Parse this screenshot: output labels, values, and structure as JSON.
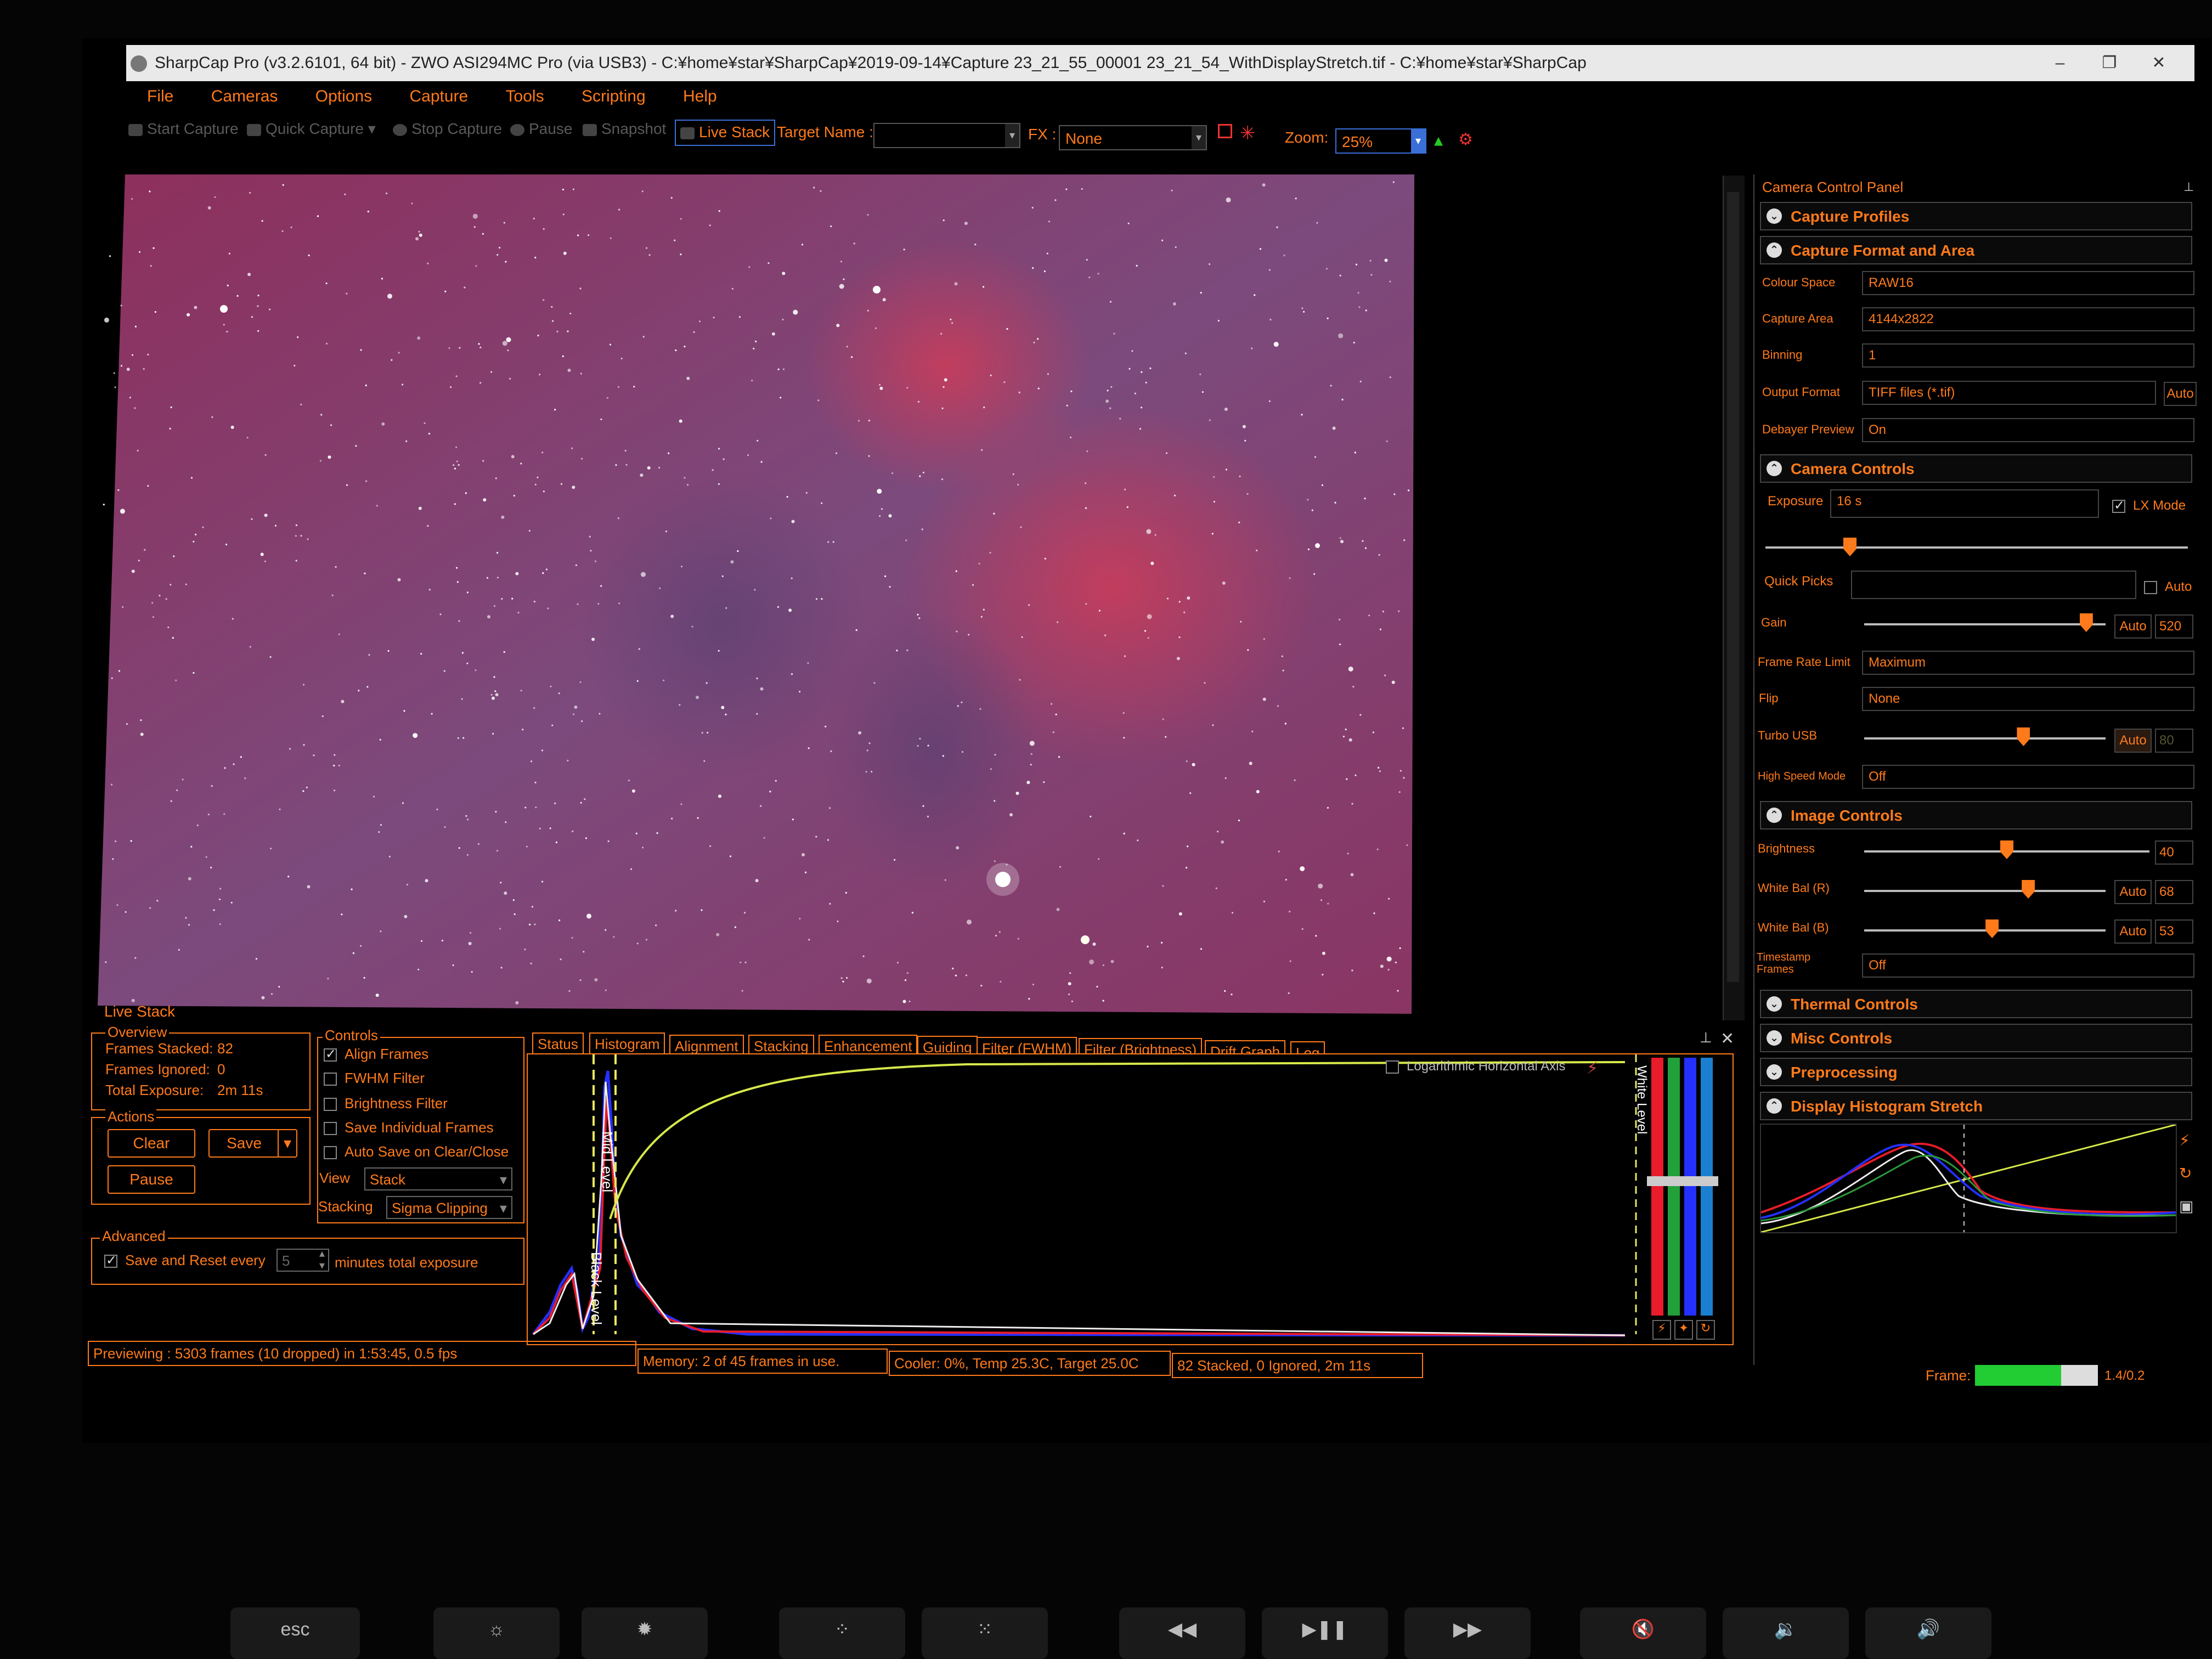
{
  "window": {
    "title": "SharpCap Pro (v3.2.6101, 64 bit) - ZWO ASI294MC Pro (via USB3) - C:¥home¥star¥SharpCap¥2019-09-14¥Capture 23_21_55_00001 23_21_54_WithDisplayStretch.tif - C:¥home¥star¥SharpCap",
    "min": "–",
    "max": "❐",
    "close": "✕"
  },
  "menu": [
    "File",
    "Cameras",
    "Options",
    "Capture",
    "Tools",
    "Scripting",
    "Help"
  ],
  "toolbar": {
    "start_capture": "Start Capture",
    "quick_capture": "Quick Capture",
    "stop_capture": "Stop Capture",
    "pause": "Pause",
    "snapshot": "Snapshot",
    "live_stack": "Live Stack",
    "target_name_label": "Target Name :",
    "target_name_value": "",
    "fx_label": "FX :",
    "fx_value": "None",
    "zoom_label": "Zoom:",
    "zoom_value": "25%"
  },
  "live_stack": {
    "title": "Live Stack",
    "overview": {
      "title": "Overview",
      "frames_stacked_label": "Frames Stacked:",
      "frames_stacked": "82",
      "frames_ignored_label": "Frames Ignored:",
      "frames_ignored": "0",
      "total_exposure_label": "Total Exposure:",
      "total_exposure": "2m 11s"
    },
    "actions": {
      "title": "Actions",
      "clear": "Clear",
      "save": "Save",
      "pause": "Pause"
    },
    "controls": {
      "title": "Controls",
      "align_frames": "Align Frames",
      "fwhm_filter": "FWHM Filter",
      "brightness_filter": "Brightness Filter",
      "save_individual": "Save Individual Frames",
      "auto_save": "Auto Save on Clear/Close",
      "view_label": "View",
      "view_value": "Stack",
      "stacking_label": "Stacking",
      "stacking_value": "Sigma Clipping"
    },
    "advanced": {
      "title": "Advanced",
      "save_reset": "Save and Reset every",
      "minutes_value": "5",
      "minutes_label": "minutes total exposure"
    }
  },
  "tabs": [
    "Status",
    "Histogram",
    "Alignment",
    "Stacking",
    "Enhancement",
    "Guiding",
    "Filter (FWHM)",
    "Filter (Brightness)",
    "Drift Graph",
    "Log"
  ],
  "histogram": {
    "log_axis": "Logarithmic Horizontal Axis",
    "mid_level": "Mid Level",
    "black_level": "Black Level",
    "white_level": "White Level"
  },
  "status": {
    "previewing": "Previewing : 5303 frames (10 dropped) in 1:53:45, 0.5 fps",
    "memory": "Memory: 2 of 45 frames in use.",
    "cooler": "Cooler: 0%, Temp 25.3C, Target 25.0C",
    "stacked": "82 Stacked, 0 Ignored, 2m 11s",
    "frame_label": "Frame:",
    "frame_value": "1.4/0.2",
    "frame_progress": 0.7
  },
  "control_panel": {
    "title": "Camera Control Panel",
    "pin": "📌",
    "sections": {
      "capture_profiles": "Capture Profiles",
      "capture_format": "Capture Format and Area",
      "camera_controls": "Camera Controls",
      "image_controls": "Image Controls",
      "thermal": "Thermal Controls",
      "misc": "Misc Controls",
      "preprocessing": "Preprocessing",
      "display_stretch": "Display Histogram Stretch"
    },
    "format": {
      "colour_space_label": "Colour Space",
      "colour_space": "RAW16",
      "capture_area_label": "Capture Area",
      "capture_area": "4144x2822",
      "binning_label": "Binning",
      "binning": "1",
      "output_format_label": "Output Format",
      "output_format": "TIFF files (*.tif)",
      "output_auto": "Auto",
      "debayer_label": "Debayer Preview",
      "debayer": "On"
    },
    "camera": {
      "exposure_label": "Exposure",
      "exposure": "16 s",
      "lx_mode": "LX Mode",
      "exposure_level": 0.2,
      "quick_picks_label": "Quick Picks",
      "quick_picks": "",
      "quick_auto": "Auto",
      "gain_label": "Gain",
      "gain_auto": "Auto",
      "gain": "520",
      "gain_level": 0.92,
      "frame_rate_label": "Frame Rate Limit",
      "frame_rate": "Maximum",
      "flip_label": "Flip",
      "flip": "None",
      "turbo_label": "Turbo USB",
      "turbo_auto": "Auto",
      "turbo": "80",
      "turbo_level": 0.66,
      "hsm_label": "High Speed Mode",
      "hsm": "Off"
    },
    "image": {
      "brightness_label": "Brightness",
      "brightness": "40",
      "brightness_level": 0.5,
      "wb_r_label": "White Bal (R)",
      "wb_r_auto": "Auto",
      "wb_r": "68",
      "wb_r_level": 0.68,
      "wb_b_label": "White Bal (B)",
      "wb_b_auto": "Auto",
      "wb_b": "53",
      "wb_b_level": 0.53,
      "timestamp_label": "Timestamp Frames",
      "timestamp": "Off"
    }
  },
  "keyboard": {
    "esc": "esc"
  },
  "colors": {
    "accent": "#ff7a1a",
    "sky": "#8a3a6a",
    "frame_bar": "#22cc33"
  }
}
